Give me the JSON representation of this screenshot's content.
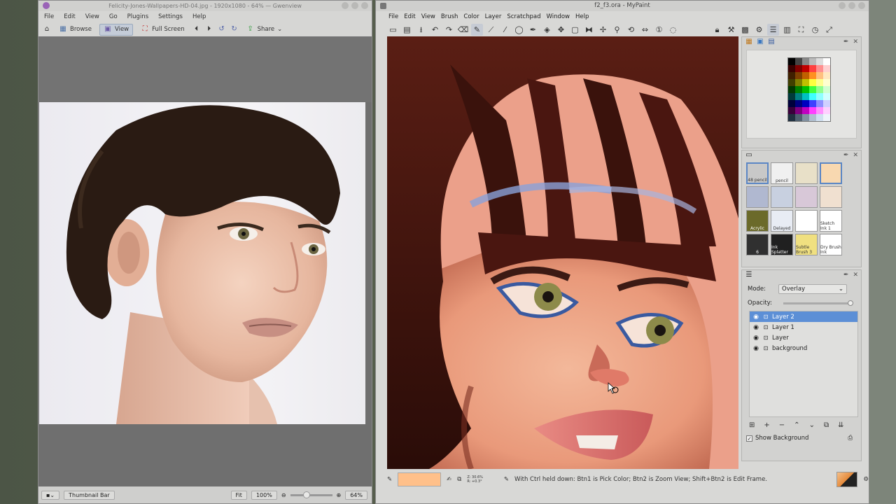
{
  "gwenview": {
    "title": "Felicity-Jones-Wallpapers-HD-04.jpg - 1920x1080 - 64% — Gwenview",
    "menu": [
      "File",
      "Edit",
      "View",
      "Go",
      "Plugins",
      "Settings",
      "Help"
    ],
    "toolbar": {
      "browse": "Browse",
      "view": "View",
      "fullscreen": "Full Screen",
      "share": "Share"
    },
    "status": {
      "thumbnail_bar": "Thumbnail Bar",
      "fit": "Fit",
      "zoom_100": "100%",
      "zoom_value": "64%"
    }
  },
  "mypaint": {
    "title": "f2_f3.ora - MyPaint",
    "menu": [
      "File",
      "Edit",
      "View",
      "Brush",
      "Color",
      "Layer",
      "Scratchpad",
      "Window",
      "Help"
    ],
    "status": {
      "zoom_info": "Z: 30.6%\nR: +0.3°",
      "hint": "With Ctrl held down:  Btn1 is Pick Color;  Btn2 is Zoom View;  Shift+Btn2 is Edit Frame."
    },
    "brushes": {
      "labels": [
        "48 pencil",
        "pencil",
        "",
        "",
        "",
        "",
        "",
        "",
        "Acrylic",
        "Delayed",
        "",
        "Sketch Ink 1",
        "6",
        "Ink Splatter",
        "Subtle Brush 3",
        "Dry Brush Ink"
      ]
    },
    "layers": {
      "mode_label": "Mode:",
      "mode_value": "Overlay",
      "opacity_label": "Opacity:",
      "opacity": 1.0,
      "items": [
        "Layer 2",
        "Layer 1",
        "Layer",
        "background"
      ],
      "show_background": "Show Background"
    },
    "colors": {
      "current": "#ffc08a"
    }
  }
}
